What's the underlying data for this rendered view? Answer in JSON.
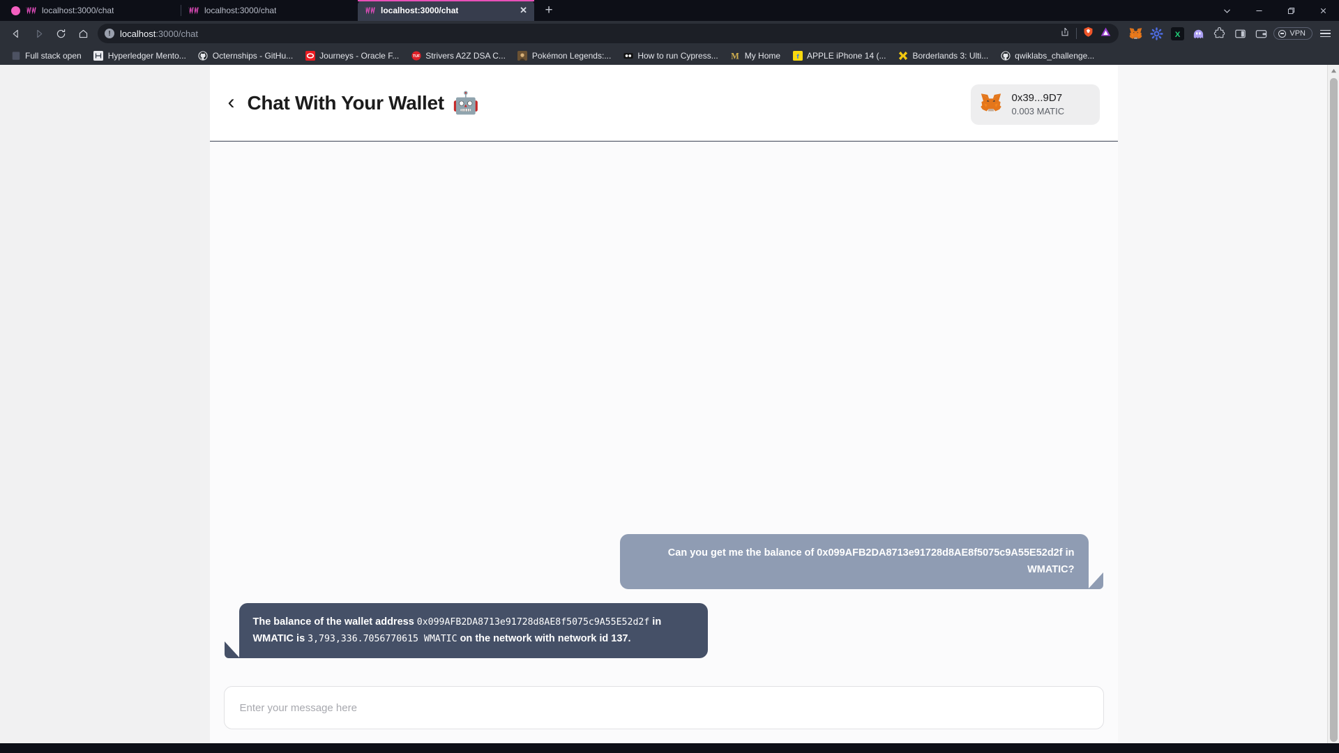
{
  "browser": {
    "tabs": [
      {
        "title": "localhost:3000/chat",
        "favicon": "wallet-connect-icon",
        "active": false,
        "recording": true
      },
      {
        "title": "localhost:3000/chat",
        "favicon": "wallet-connect-icon",
        "active": false,
        "recording": false
      },
      {
        "title": "localhost:3000/chat",
        "favicon": "wallet-connect-icon",
        "active": true,
        "recording": false
      }
    ],
    "new_tab_label": "+",
    "window_controls": [
      {
        "name": "tab-search-button",
        "glyph": "⌄"
      },
      {
        "name": "minimize-button",
        "glyph": "—"
      },
      {
        "name": "maximize-button",
        "glyph": "❐"
      },
      {
        "name": "close-button",
        "glyph": "✕"
      }
    ],
    "nav": {
      "back_label": "◁",
      "forward_label": "▷",
      "reload_label": "↻",
      "home_label": "⌂",
      "bookmark_label": "☆"
    },
    "omnibox": {
      "info_glyph": "!",
      "url_host": "localhost",
      "url_path": ":3000/chat",
      "share_label": "↪"
    },
    "extensions": [
      {
        "name": "metamask-extension-icon",
        "label": "MetaMask"
      },
      {
        "name": "gear-extension-icon",
        "label": "Settings"
      },
      {
        "name": "excel-extension-icon",
        "label": "X"
      },
      {
        "name": "phantom-extension-icon",
        "label": "Phantom"
      },
      {
        "name": "puzzle-extensions-icon",
        "label": "Extensions"
      },
      {
        "name": "sidebar-panel-icon",
        "label": "Sidebar"
      },
      {
        "name": "wallet-icon",
        "label": "Wallet"
      }
    ],
    "vpn_label": "VPN",
    "menu_label": "Menu",
    "bookmarks": [
      {
        "label": "Full stack open",
        "icon": "doc-icon"
      },
      {
        "label": "Hyperledger Mento...",
        "icon": "hyperledger-icon"
      },
      {
        "label": "Octernships - GitHu...",
        "icon": "github-icon"
      },
      {
        "label": "Journeys - Oracle F...",
        "icon": "oracle-icon"
      },
      {
        "label": "Strivers A2Z DSA C...",
        "icon": "takeuforward-icon"
      },
      {
        "label": "Pokémon Legends:...",
        "icon": "pokemon-icon"
      },
      {
        "label": "How to run Cypress...",
        "icon": "video-icon"
      },
      {
        "label": "My Home",
        "icon": "m-icon"
      },
      {
        "label": "APPLE iPhone 14 (...",
        "icon": "flipkart-icon"
      },
      {
        "label": "Borderlands 3: Ulti...",
        "icon": "borderlands-icon"
      },
      {
        "label": "qwiklabs_challenge...",
        "icon": "github-icon"
      }
    ]
  },
  "app": {
    "back_button_label": "‹",
    "title": "Chat With Your Wallet",
    "title_emoji": "🤖",
    "wallet": {
      "icon": "metamask-fox-icon",
      "address": "0x39...9D7",
      "balance": "0.003 MATIC"
    },
    "messages": [
      {
        "role": "user",
        "segments": [
          {
            "type": "text",
            "value": "Can you get me the balance of 0x099AFB2DA8713e91728d8AE8f5075c9A55E52d2f in WMATIC?"
          }
        ]
      },
      {
        "role": "bot",
        "segments": [
          {
            "type": "text",
            "value": "The balance of the wallet address "
          },
          {
            "type": "mono",
            "value": "0x099AFB2DA8713e91728d8AE8f5075c9A55E52d2f"
          },
          {
            "type": "text",
            "value": " in WMATIC is "
          },
          {
            "type": "mono",
            "value": "3,793,336.7056770615 WMATIC"
          },
          {
            "type": "text",
            "value": " on the network with network id 137."
          }
        ]
      }
    ],
    "composer": {
      "placeholder": "Enter your message here",
      "value": ""
    }
  },
  "colors": {
    "user_bubble": "#8f9cb3",
    "bot_bubble": "#455067",
    "tab_accent": "#e850b8",
    "nav_bg": "#2c3038",
    "page_bg": "#ffffff"
  }
}
